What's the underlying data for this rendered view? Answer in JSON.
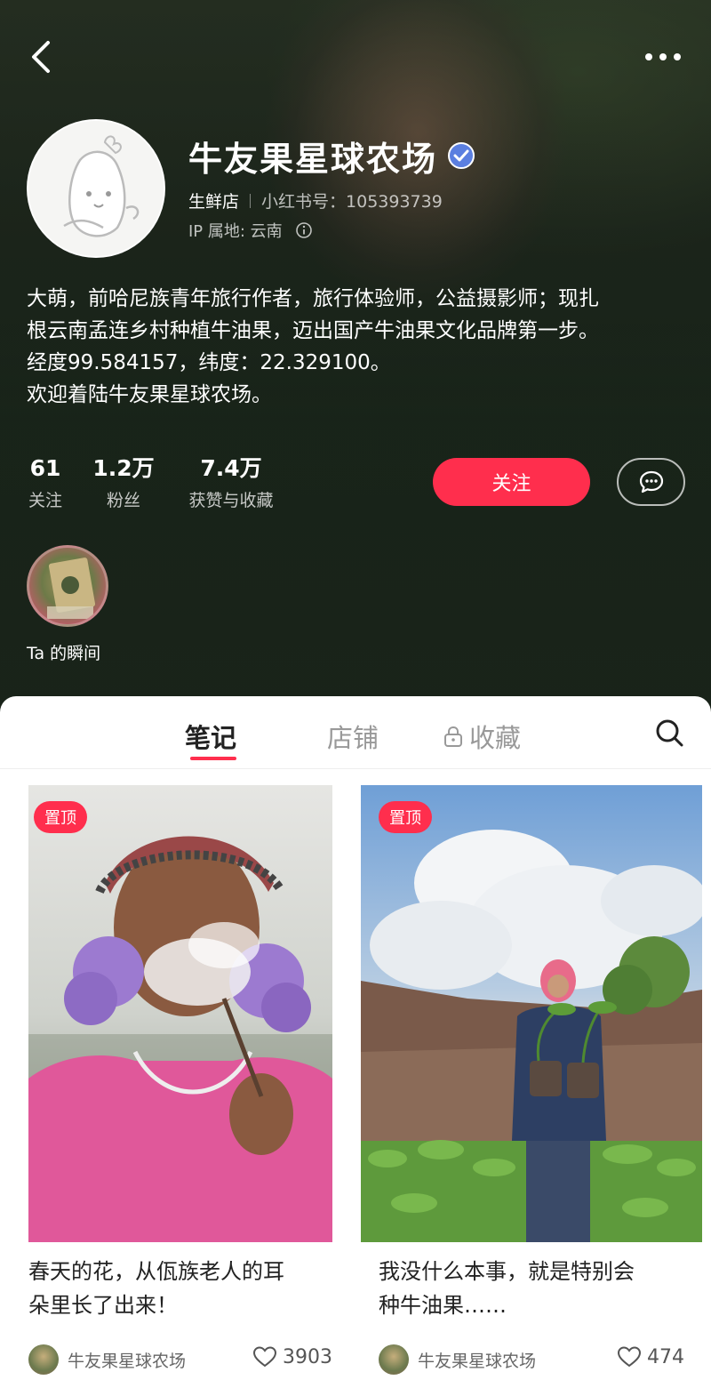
{
  "profile": {
    "name": "牛友果星球农场",
    "type": "生鲜店",
    "id_label": "小红书号：105393739",
    "ip_label": "IP 属地: 云南",
    "bio_lines": [
      "大萌，前哈尼族青年旅行作者，旅行体验师，公益摄影师；现扎",
      "根云南孟连乡村种植牛油果，迈出国产牛油果文化品牌第一步。",
      "经度99.584157，纬度：22.329100。",
      "欢迎着陆牛友果星球农场。"
    ]
  },
  "stats": [
    {
      "num": "61",
      "label": "关注"
    },
    {
      "num": "1.2万",
      "label": "粉丝"
    },
    {
      "num": "7.4万",
      "label": "获赞与收藏"
    }
  ],
  "actions": {
    "follow_label": "关注"
  },
  "moments": {
    "label": "Ta 的瞬间"
  },
  "tabs": [
    {
      "label": "笔记",
      "active": true
    },
    {
      "label": "店铺"
    },
    {
      "label": "收藏",
      "locked": true
    }
  ],
  "notes": [
    {
      "badge": "置顶",
      "title_lines": [
        "春天的花，从佤族老人的耳",
        "朵里长了出来！"
      ],
      "author": "牛友果星球农场",
      "likes": "3903"
    },
    {
      "badge": "置顶",
      "title_lines": [
        "我没什么本事，就是特别会",
        "种牛油果……"
      ],
      "author": "牛友果星球农场",
      "likes": "474"
    }
  ],
  "icons": {
    "back": "chevron-left-icon",
    "more": "more-dots-icon",
    "verified": "verified-badge-icon",
    "message": "chat-bubble-icon",
    "search": "search-icon",
    "lock": "lock-icon",
    "heart": "heart-icon"
  },
  "colors": {
    "accent": "#ff2e4d",
    "verified": "#5b7fe0"
  }
}
